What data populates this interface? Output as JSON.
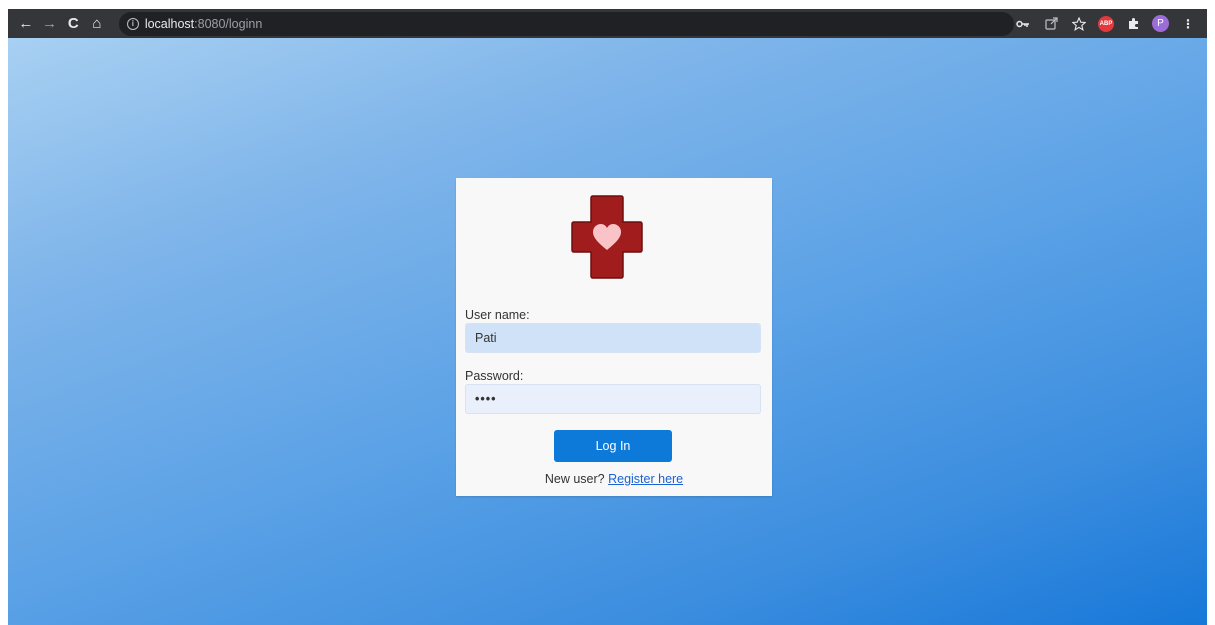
{
  "browser": {
    "url_host": "localhost",
    "url_path": ":8080/loginn",
    "nav": {
      "back": "←",
      "forward": "→",
      "reload": "C",
      "home": "⌂"
    },
    "extensions": {
      "abp_label": "ABP",
      "profile_initial": "P"
    }
  },
  "login": {
    "username_label": "User name:",
    "username_value": "Pati",
    "password_label": "Password:",
    "password_value": "••••",
    "login_button": "Log In",
    "new_user_text": "New user?",
    "register_link": "Register here"
  },
  "colors": {
    "logo_cross": "#a11c1c",
    "logo_heart": "#f9c3c8",
    "button": "#0d7ad9"
  }
}
